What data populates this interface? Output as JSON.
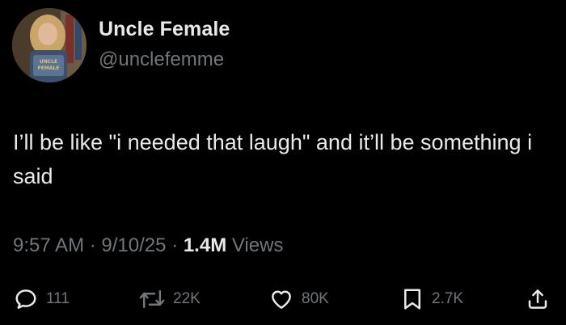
{
  "user": {
    "display_name": "Uncle Female",
    "handle": "@unclefemme",
    "avatar_shirt_text_line1": "UNCLE",
    "avatar_shirt_text_line2": "FEMALE"
  },
  "tweet": {
    "text": "I’ll be like \"i needed that laugh\" and it’ll be something i said"
  },
  "meta": {
    "time": "9:57 AM",
    "separator": "·",
    "date": "9/10/25",
    "views_count": "1.4M",
    "views_label": "Views"
  },
  "actions": {
    "replies": "111",
    "reposts": "22K",
    "likes": "80K",
    "bookmarks": "2.7K"
  },
  "colors": {
    "background": "#000000",
    "primary_text": "#e7e9ea",
    "secondary_text": "#71767b"
  },
  "icons": {
    "reply": "reply-icon",
    "repost": "repost-icon",
    "like": "heart-icon",
    "bookmark": "bookmark-icon",
    "share": "share-icon"
  }
}
